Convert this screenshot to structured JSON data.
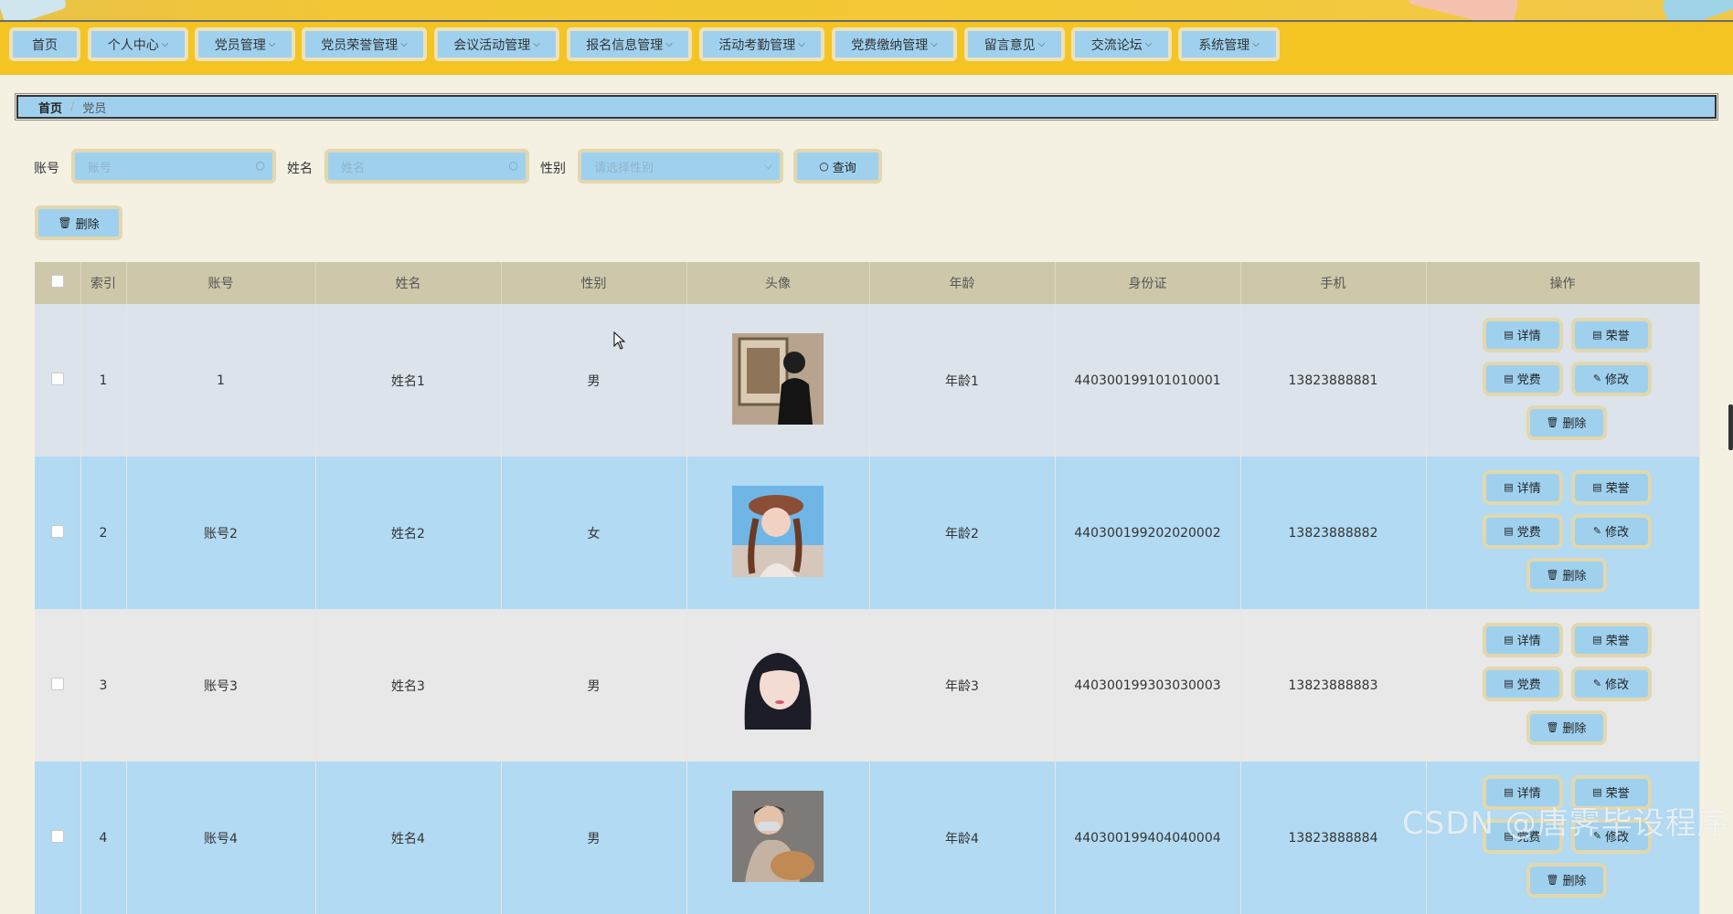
{
  "nav": {
    "items": [
      {
        "label": "首页",
        "has_menu": false
      },
      {
        "label": "个人中心",
        "has_menu": true
      },
      {
        "label": "党员管理",
        "has_menu": true
      },
      {
        "label": "党员荣誉管理",
        "has_menu": true
      },
      {
        "label": "会议活动管理",
        "has_menu": true
      },
      {
        "label": "报名信息管理",
        "has_menu": true
      },
      {
        "label": "活动考勤管理",
        "has_menu": true
      },
      {
        "label": "党费缴纳管理",
        "has_menu": true
      },
      {
        "label": "留言意见",
        "has_menu": true
      },
      {
        "label": "交流论坛",
        "has_menu": true
      },
      {
        "label": "系统管理",
        "has_menu": true
      }
    ]
  },
  "breadcrumb": {
    "home": "首页",
    "separator": "/",
    "current": "党员"
  },
  "search": {
    "account_label": "账号",
    "account_placeholder": "账号",
    "name_label": "姓名",
    "name_placeholder": "姓名",
    "gender_label": "性别",
    "gender_placeholder": "请选择性别",
    "query_label": "查询"
  },
  "toolbar": {
    "delete_label": "删除"
  },
  "table": {
    "headers": [
      "索引",
      "账号",
      "姓名",
      "性别",
      "头像",
      "年龄",
      "身份证",
      "手机",
      "操作"
    ],
    "rows": [
      {
        "index": "1",
        "account": "1",
        "name": "姓名1",
        "gender": "男",
        "age": "年龄1",
        "id_card": "440300199101010001",
        "phone": "13823888881"
      },
      {
        "index": "2",
        "account": "账号2",
        "name": "姓名2",
        "gender": "女",
        "age": "年龄2",
        "id_card": "440300199202020002",
        "phone": "13823888882"
      },
      {
        "index": "3",
        "account": "账号3",
        "name": "姓名3",
        "gender": "男",
        "age": "年龄3",
        "id_card": "440300199303030003",
        "phone": "13823888883"
      },
      {
        "index": "4",
        "account": "账号4",
        "name": "姓名4",
        "gender": "男",
        "age": "年龄4",
        "id_card": "440300199404040004",
        "phone": "13823888884"
      }
    ],
    "actions": {
      "detail": "详情",
      "honor": "荣誉",
      "fee": "党费",
      "edit": "修改",
      "delete": "删除"
    }
  },
  "watermark": "CSDN @唐霁毕设程序",
  "colors": {
    "nav_bg": "#f4c423",
    "button_bg": "#9fd1ef",
    "button_border": "#e2d7ae",
    "header_bg": "#cdc8a9",
    "page_bg": "#f4f0e2"
  }
}
